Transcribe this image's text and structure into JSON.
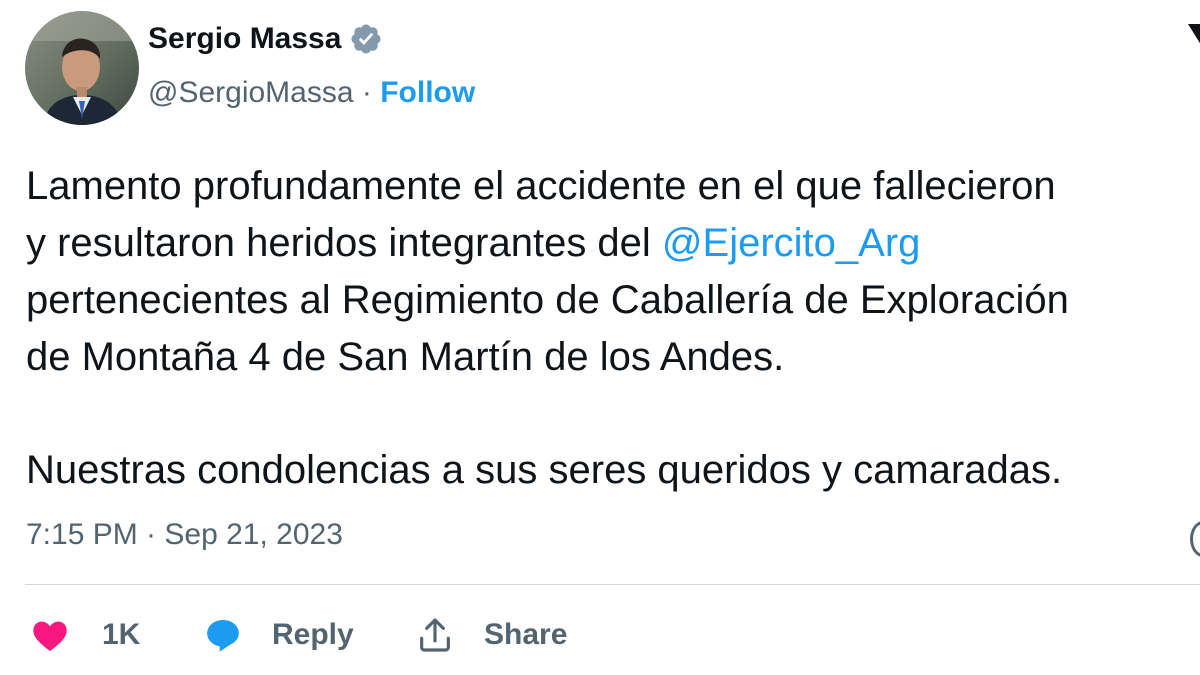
{
  "author": {
    "name": "Sergio Massa",
    "handle": "@SergioMassa",
    "separator": "·",
    "follow_label": "Follow",
    "verified_icon": "verified-badge-icon"
  },
  "tweet": {
    "line1": "Lamento profundamente el accidente en el que fallecieron",
    "line2_before": "y resultaron heridos integrantes del ",
    "line2_mention": "@Ejercito_Arg",
    "line3": "pertenecientes al Regimiento de Caballería de Exploración",
    "line4": "de Montaña 4 de San Martín de los Andes.",
    "line5": "Nuestras condolencias a sus seres queridos y camaradas."
  },
  "meta": {
    "timestamp": "7:15 PM · Sep 21, 2023"
  },
  "actions": {
    "like_count": "1K",
    "reply_label": "Reply",
    "share_label": "Share"
  },
  "colors": {
    "accent": "#1d9bf0",
    "like": "#f91880",
    "text": "#0f1419",
    "muted": "#536471",
    "divider": "#cfd9de"
  }
}
